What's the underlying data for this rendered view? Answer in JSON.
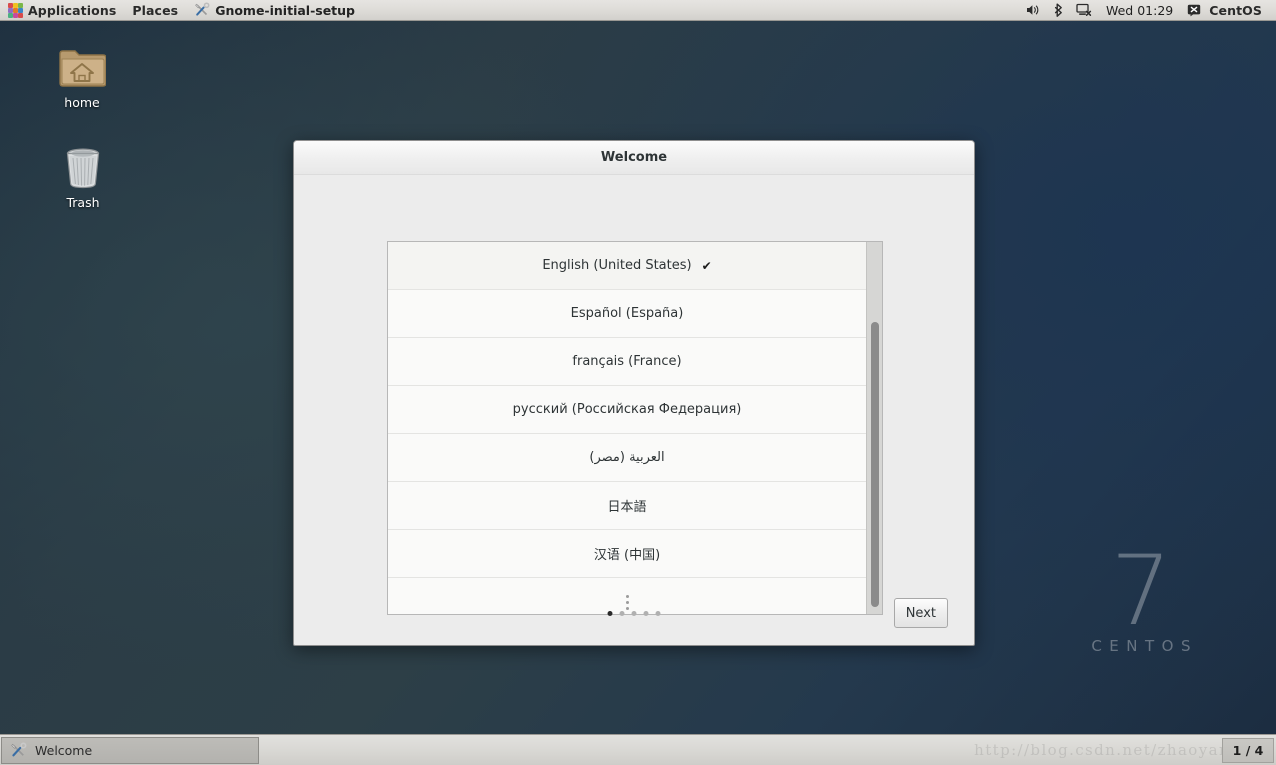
{
  "top_panel": {
    "applications_label": "Applications",
    "places_label": "Places",
    "active_window_label": "Gnome-initial-setup",
    "applications_icon": "applications-pinwheel-icon",
    "window_icon": "wrench-screwdriver-icon",
    "tray": {
      "volume_icon": "volume-speaker-icon",
      "bluetooth_icon": "bluetooth-icon",
      "network_icon": "network-disconnected-icon",
      "clock": "Wed 01:29",
      "user_icon": "user-session-icon",
      "user_label": "CentOS"
    }
  },
  "desktop": {
    "icons": [
      {
        "name": "home",
        "label": "home",
        "icon": "home-folder-icon"
      },
      {
        "name": "trash",
        "label": "Trash",
        "icon": "trash-bin-icon"
      }
    ],
    "branding": {
      "version": "7",
      "product": "CENTOS"
    }
  },
  "dialog": {
    "title": "Welcome",
    "languages": [
      {
        "label": "English (United States)",
        "selected": true,
        "check": "✔"
      },
      {
        "label": "Español (España)",
        "selected": false
      },
      {
        "label": "français (France)",
        "selected": false
      },
      {
        "label": "русский (Российская Федерация)",
        "selected": false
      },
      {
        "label": "العربية (مصر)",
        "selected": false
      },
      {
        "label": "日本語",
        "selected": false
      },
      {
        "label": "汉语 (中国)",
        "selected": false
      }
    ],
    "more_indicator": "more-languages-icon",
    "page_dots": {
      "total": 5,
      "active_index": 0
    },
    "next_label": "Next"
  },
  "bottom_panel": {
    "window_button_label": "Welcome",
    "window_button_icon": "wrench-screwdriver-icon",
    "watermark": "http://blog.csdn.net/zhaoyan",
    "workspace": "1 / 4"
  },
  "colors": {
    "desktop_base": "#2d3f47",
    "desktop_right": "#1c3452",
    "panel_bg": "#dedcd8",
    "dialog_bg": "#ececec",
    "list_bg": "#fafaf9",
    "selected_row": "#f4f4f2",
    "accent_dot": "#2a2a2a"
  }
}
